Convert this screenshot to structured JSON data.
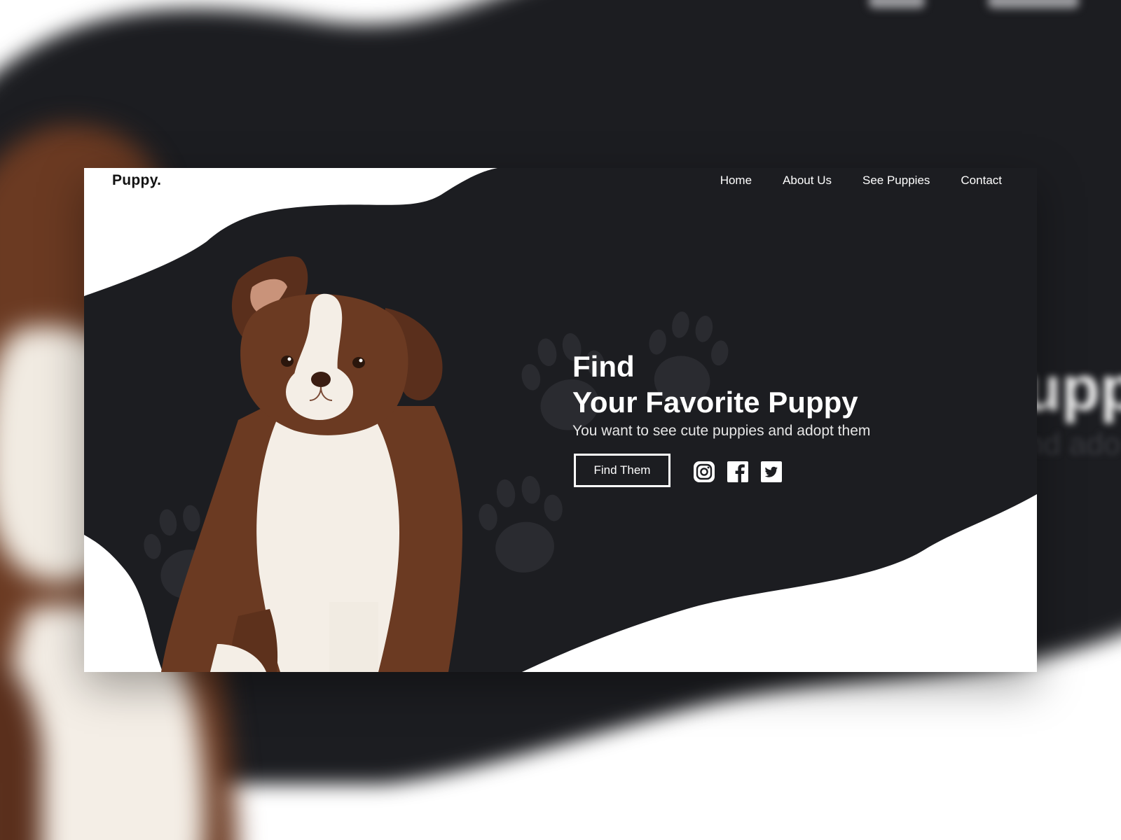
{
  "brand": {
    "logo": "Puppy."
  },
  "nav": {
    "items": [
      "Home",
      "About Us",
      "See Puppies",
      "Contact"
    ]
  },
  "hero": {
    "title_line1": "Find",
    "title_line2": "Your Favorite Puppy",
    "subtitle": "You want to see cute puppies and adopt them",
    "cta_label": "Find Them"
  },
  "social": {
    "icons": [
      "instagram-icon",
      "facebook-icon",
      "twitter-icon"
    ]
  },
  "background": {
    "title_fragment": "upp",
    "subtitle_fragment": "nd ado"
  },
  "colors": {
    "dark": "#1c1d21",
    "white": "#ffffff",
    "puppy_brown": "#6b3a22",
    "puppy_cream": "#f4eee6"
  }
}
